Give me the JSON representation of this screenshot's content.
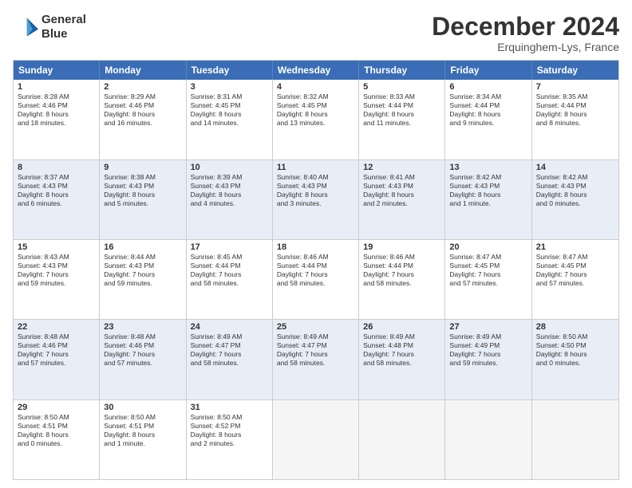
{
  "logo": {
    "line1": "General",
    "line2": "Blue"
  },
  "title": "December 2024",
  "subtitle": "Erquinghem-Lys, France",
  "header_days": [
    "Sunday",
    "Monday",
    "Tuesday",
    "Wednesday",
    "Thursday",
    "Friday",
    "Saturday"
  ],
  "weeks": [
    {
      "alt": false,
      "days": [
        {
          "num": "1",
          "lines": [
            "Sunrise: 8:28 AM",
            "Sunset: 4:46 PM",
            "Daylight: 8 hours",
            "and 18 minutes."
          ]
        },
        {
          "num": "2",
          "lines": [
            "Sunrise: 8:29 AM",
            "Sunset: 4:46 PM",
            "Daylight: 8 hours",
            "and 16 minutes."
          ]
        },
        {
          "num": "3",
          "lines": [
            "Sunrise: 8:31 AM",
            "Sunset: 4:45 PM",
            "Daylight: 8 hours",
            "and 14 minutes."
          ]
        },
        {
          "num": "4",
          "lines": [
            "Sunrise: 8:32 AM",
            "Sunset: 4:45 PM",
            "Daylight: 8 hours",
            "and 13 minutes."
          ]
        },
        {
          "num": "5",
          "lines": [
            "Sunrise: 8:33 AM",
            "Sunset: 4:44 PM",
            "Daylight: 8 hours",
            "and 11 minutes."
          ]
        },
        {
          "num": "6",
          "lines": [
            "Sunrise: 8:34 AM",
            "Sunset: 4:44 PM",
            "Daylight: 8 hours",
            "and 9 minutes."
          ]
        },
        {
          "num": "7",
          "lines": [
            "Sunrise: 8:35 AM",
            "Sunset: 4:44 PM",
            "Daylight: 8 hours",
            "and 8 minutes."
          ]
        }
      ]
    },
    {
      "alt": true,
      "days": [
        {
          "num": "8",
          "lines": [
            "Sunrise: 8:37 AM",
            "Sunset: 4:43 PM",
            "Daylight: 8 hours",
            "and 6 minutes."
          ]
        },
        {
          "num": "9",
          "lines": [
            "Sunrise: 8:38 AM",
            "Sunset: 4:43 PM",
            "Daylight: 8 hours",
            "and 5 minutes."
          ]
        },
        {
          "num": "10",
          "lines": [
            "Sunrise: 8:39 AM",
            "Sunset: 4:43 PM",
            "Daylight: 8 hours",
            "and 4 minutes."
          ]
        },
        {
          "num": "11",
          "lines": [
            "Sunrise: 8:40 AM",
            "Sunset: 4:43 PM",
            "Daylight: 8 hours",
            "and 3 minutes."
          ]
        },
        {
          "num": "12",
          "lines": [
            "Sunrise: 8:41 AM",
            "Sunset: 4:43 PM",
            "Daylight: 8 hours",
            "and 2 minutes."
          ]
        },
        {
          "num": "13",
          "lines": [
            "Sunrise: 8:42 AM",
            "Sunset: 4:43 PM",
            "Daylight: 8 hours",
            "and 1 minute."
          ]
        },
        {
          "num": "14",
          "lines": [
            "Sunrise: 8:42 AM",
            "Sunset: 4:43 PM",
            "Daylight: 8 hours",
            "and 0 minutes."
          ]
        }
      ]
    },
    {
      "alt": false,
      "days": [
        {
          "num": "15",
          "lines": [
            "Sunrise: 8:43 AM",
            "Sunset: 4:43 PM",
            "Daylight: 7 hours",
            "and 59 minutes."
          ]
        },
        {
          "num": "16",
          "lines": [
            "Sunrise: 8:44 AM",
            "Sunset: 4:43 PM",
            "Daylight: 7 hours",
            "and 59 minutes."
          ]
        },
        {
          "num": "17",
          "lines": [
            "Sunrise: 8:45 AM",
            "Sunset: 4:44 PM",
            "Daylight: 7 hours",
            "and 58 minutes."
          ]
        },
        {
          "num": "18",
          "lines": [
            "Sunrise: 8:46 AM",
            "Sunset: 4:44 PM",
            "Daylight: 7 hours",
            "and 58 minutes."
          ]
        },
        {
          "num": "19",
          "lines": [
            "Sunrise: 8:46 AM",
            "Sunset: 4:44 PM",
            "Daylight: 7 hours",
            "and 58 minutes."
          ]
        },
        {
          "num": "20",
          "lines": [
            "Sunrise: 8:47 AM",
            "Sunset: 4:45 PM",
            "Daylight: 7 hours",
            "and 57 minutes."
          ]
        },
        {
          "num": "21",
          "lines": [
            "Sunrise: 8:47 AM",
            "Sunset: 4:45 PM",
            "Daylight: 7 hours",
            "and 57 minutes."
          ]
        }
      ]
    },
    {
      "alt": true,
      "days": [
        {
          "num": "22",
          "lines": [
            "Sunrise: 8:48 AM",
            "Sunset: 4:46 PM",
            "Daylight: 7 hours",
            "and 57 minutes."
          ]
        },
        {
          "num": "23",
          "lines": [
            "Sunrise: 8:48 AM",
            "Sunset: 4:46 PM",
            "Daylight: 7 hours",
            "and 57 minutes."
          ]
        },
        {
          "num": "24",
          "lines": [
            "Sunrise: 8:49 AM",
            "Sunset: 4:47 PM",
            "Daylight: 7 hours",
            "and 58 minutes."
          ]
        },
        {
          "num": "25",
          "lines": [
            "Sunrise: 8:49 AM",
            "Sunset: 4:47 PM",
            "Daylight: 7 hours",
            "and 58 minutes."
          ]
        },
        {
          "num": "26",
          "lines": [
            "Sunrise: 8:49 AM",
            "Sunset: 4:48 PM",
            "Daylight: 7 hours",
            "and 58 minutes."
          ]
        },
        {
          "num": "27",
          "lines": [
            "Sunrise: 8:49 AM",
            "Sunset: 4:49 PM",
            "Daylight: 7 hours",
            "and 59 minutes."
          ]
        },
        {
          "num": "28",
          "lines": [
            "Sunrise: 8:50 AM",
            "Sunset: 4:50 PM",
            "Daylight: 8 hours",
            "and 0 minutes."
          ]
        }
      ]
    },
    {
      "alt": false,
      "days": [
        {
          "num": "29",
          "lines": [
            "Sunrise: 8:50 AM",
            "Sunset: 4:51 PM",
            "Daylight: 8 hours",
            "and 0 minutes."
          ]
        },
        {
          "num": "30",
          "lines": [
            "Sunrise: 8:50 AM",
            "Sunset: 4:51 PM",
            "Daylight: 8 hours",
            "and 1 minute."
          ]
        },
        {
          "num": "31",
          "lines": [
            "Sunrise: 8:50 AM",
            "Sunset: 4:52 PM",
            "Daylight: 8 hours",
            "and 2 minutes."
          ]
        },
        {
          "num": "",
          "lines": []
        },
        {
          "num": "",
          "lines": []
        },
        {
          "num": "",
          "lines": []
        },
        {
          "num": "",
          "lines": []
        }
      ]
    }
  ]
}
